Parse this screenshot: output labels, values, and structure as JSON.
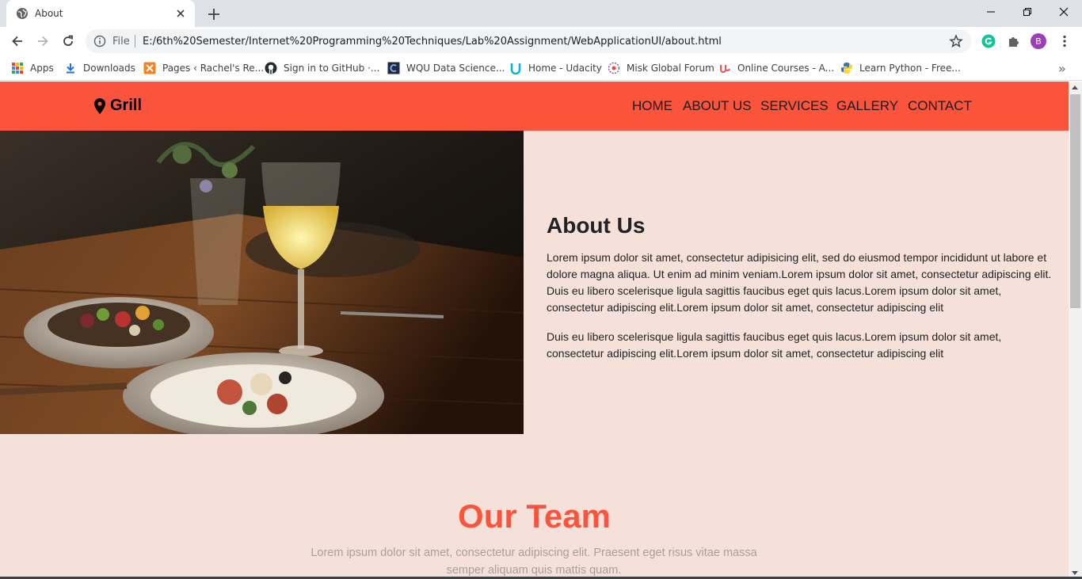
{
  "browser": {
    "tab_title": "About",
    "url_scheme": "File",
    "url": "E:/6th%20Semester/Internet%20Programming%20Techniques/Lab%20Assignment/WebApplicationUI/about.html",
    "profile_initial": "B",
    "bookmarks": [
      {
        "label": "Apps",
        "icon": "apps-grid-icon"
      },
      {
        "label": "Downloads",
        "icon": "download-icon"
      },
      {
        "label": "Pages ‹ Rachel's Re...",
        "icon": "pages-icon"
      },
      {
        "label": "Sign in to GitHub ·...",
        "icon": "github-icon"
      },
      {
        "label": "WQU Data Science...",
        "icon": "wqu-icon"
      },
      {
        "label": "Home - Udacity",
        "icon": "udacity-icon"
      },
      {
        "label": "Misk Global Forum",
        "icon": "misk-icon"
      },
      {
        "label": "Online Courses - A...",
        "icon": "udemy-icon"
      },
      {
        "label": "Learn Python - Free...",
        "icon": "python-icon"
      }
    ],
    "more_bookmarks": "»"
  },
  "site": {
    "brand": "Grill",
    "nav": [
      "HOME",
      "ABOUT US",
      "SERVICES",
      "GALLERY",
      "CONTACT"
    ],
    "accent": "#fa543c",
    "background": "#f5e1d9"
  },
  "about": {
    "heading": "About Us",
    "paragraphs": [
      "Lorem ipsum dolor sit amet, consectetur adipisicing elit, sed do eiusmod tempor incididunt ut labore et dolore magna aliqua. Ut enim ad minim veniam.Lorem ipsum dolor sit amet, consectetur adipiscing elit. Duis eu libero scelerisque ligula sagittis faucibus eget quis lacus.Lorem ipsum dolor sit amet, consectetur adipiscing elit.Lorem ipsum dolor sit amet, consectetur adipiscing elit",
      "Duis eu libero scelerisque ligula sagittis faucibus eget quis lacus.Lorem ipsum dolor sit amet, consectetur adipiscing elit.Lorem ipsum dolor sit amet, consectetur adipiscing elit"
    ]
  },
  "team": {
    "heading": "Our Team",
    "subtitle": "Lorem ipsum dolor sit amet, consectetur adipiscing elit. Praesent eget risus vitae massa semper aliquam quis mattis quam."
  }
}
